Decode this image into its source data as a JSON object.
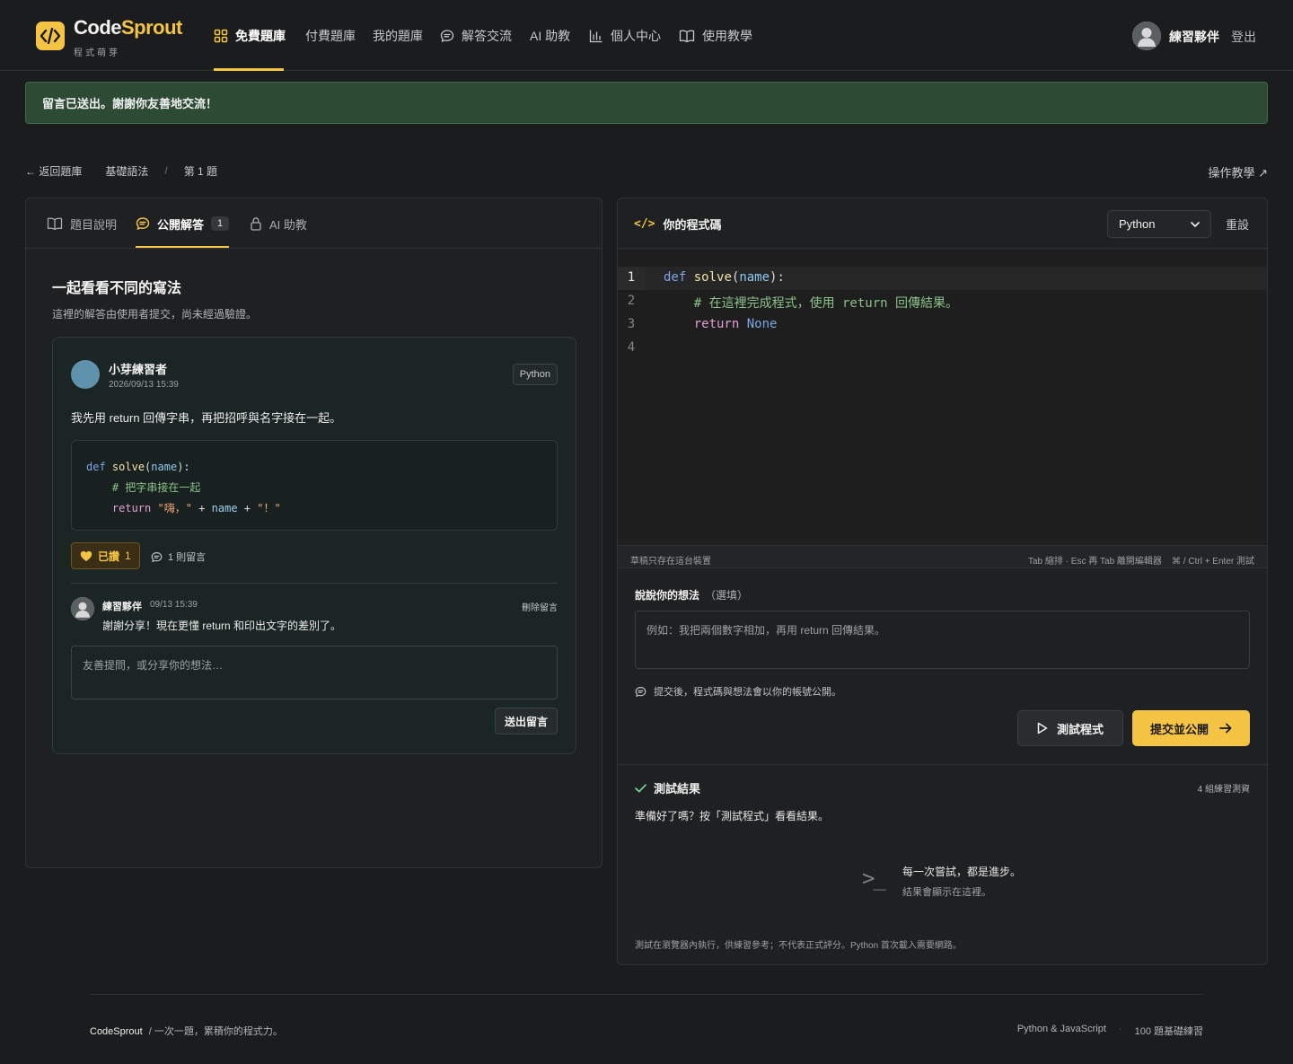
{
  "brand": {
    "name_a": "Code",
    "name_b": "Sprout",
    "sub": "程式萌芽"
  },
  "nav": [
    {
      "label": "免費題庫",
      "icon": "grid-icon",
      "active": true
    },
    {
      "label": "付費題庫",
      "icon": "",
      "active": false
    },
    {
      "label": "我的題庫",
      "icon": "",
      "active": false
    },
    {
      "label": "解答交流",
      "icon": "chat-icon",
      "active": false
    },
    {
      "label": "AI 助教",
      "icon": "",
      "active": false
    },
    {
      "label": "個人中心",
      "icon": "bar-chart-icon",
      "active": false
    },
    {
      "label": "使用教學",
      "icon": "book-icon",
      "active": false
    }
  ],
  "user": {
    "name": "練習夥伴",
    "logout": "登出"
  },
  "alert": {
    "text": "留言已送出。謝謝你友善地交流！"
  },
  "breadcrumb": {
    "back": "← 返回題庫",
    "category": "基礎語法",
    "sep": "/",
    "item": "第 1 題",
    "tutorial": "操作教學 ↗"
  },
  "left_tabs": {
    "description": "題目說明",
    "solutions": "公開解答",
    "solutions_count": "1",
    "ai": "AI 助教"
  },
  "solutions": {
    "title": "一起看看不同的寫法",
    "subtitle": "這裡的解答由使用者提交，尚未經過驗證。",
    "card": {
      "author": "小芽練習者",
      "time": "2026/09/13 15:39",
      "lang": "Python",
      "body": "我先用 return 回傳字串，再把招呼與名字接在一起。",
      "code": {
        "l1_kw": "def",
        "l1_fn": "solve",
        "l1_open": "(",
        "l1_param": "name",
        "l1_close": "):",
        "l2_comment": "# 把字串接在一起",
        "l3_kw": "return",
        "l3_s1": "\"嗨，\"",
        "l3_plus1": "+",
        "l3_id": "name",
        "l3_plus2": "+",
        "l3_s2": "\"！\""
      },
      "likes_label": "已讚",
      "likes_count": "1",
      "comments": "1 則留言",
      "reply": {
        "author": "練習夥伴",
        "time": "09/13 15:39",
        "delete": "刪除留言",
        "body": "謝謝分享！現在更懂 return 和印出文字的差別了。"
      },
      "reply_placeholder": "友善提問，或分享你的想法…",
      "send": "送出留言"
    }
  },
  "editor": {
    "title_tag": "</>",
    "title": "你的程式碼",
    "language": "Python",
    "reset": "重設",
    "line_numbers": [
      "1",
      "2",
      "3",
      "4"
    ],
    "code": {
      "l1_kw": "def",
      "l1_fn": "solve",
      "l1_open": "(",
      "l1_param": "name",
      "l1_close": "):",
      "l2_comment": "# 在這裡完成程式，使用 return 回傳結果。",
      "l3_kw": "return",
      "l3_val": "None"
    },
    "status_left": "草稿只存在這台裝置",
    "status_right": "Tab 縮排 · Esc 再 Tab 離開編輯器    ⌘ / Ctrl + Enter 測試"
  },
  "thoughts": {
    "label": "說說你的想法",
    "optional": "（選填）",
    "placeholder": "例如：我把兩個數字相加，再用 return 回傳結果。",
    "note": "提交後，程式碼與想法會以你的帳號公開。"
  },
  "actions": {
    "test": "測試程式",
    "submit": "提交並公開"
  },
  "results": {
    "title": "測試結果",
    "count": "4 組練習測資",
    "ready": "準備好了嗎？按「測試程式」看看結果。",
    "prompt": ">_",
    "empty_title": "每一次嘗試，都是進步。",
    "empty_sub": "結果會顯示在這裡。",
    "note": "測試在瀏覽器內執行，供練習參考；不代表正式評分。Python 首次載入需要網路。"
  },
  "footer": {
    "brand": "CodeSprout",
    "tagline": "/  一次一題，累積你的程式力。",
    "right_1": "Python & JavaScript",
    "dot": "·",
    "right_2": "100 題基礎練習"
  },
  "colors": {
    "accent": "#f6c445",
    "success_bg": "#2c4a34",
    "bg": "#1a1c1d"
  }
}
